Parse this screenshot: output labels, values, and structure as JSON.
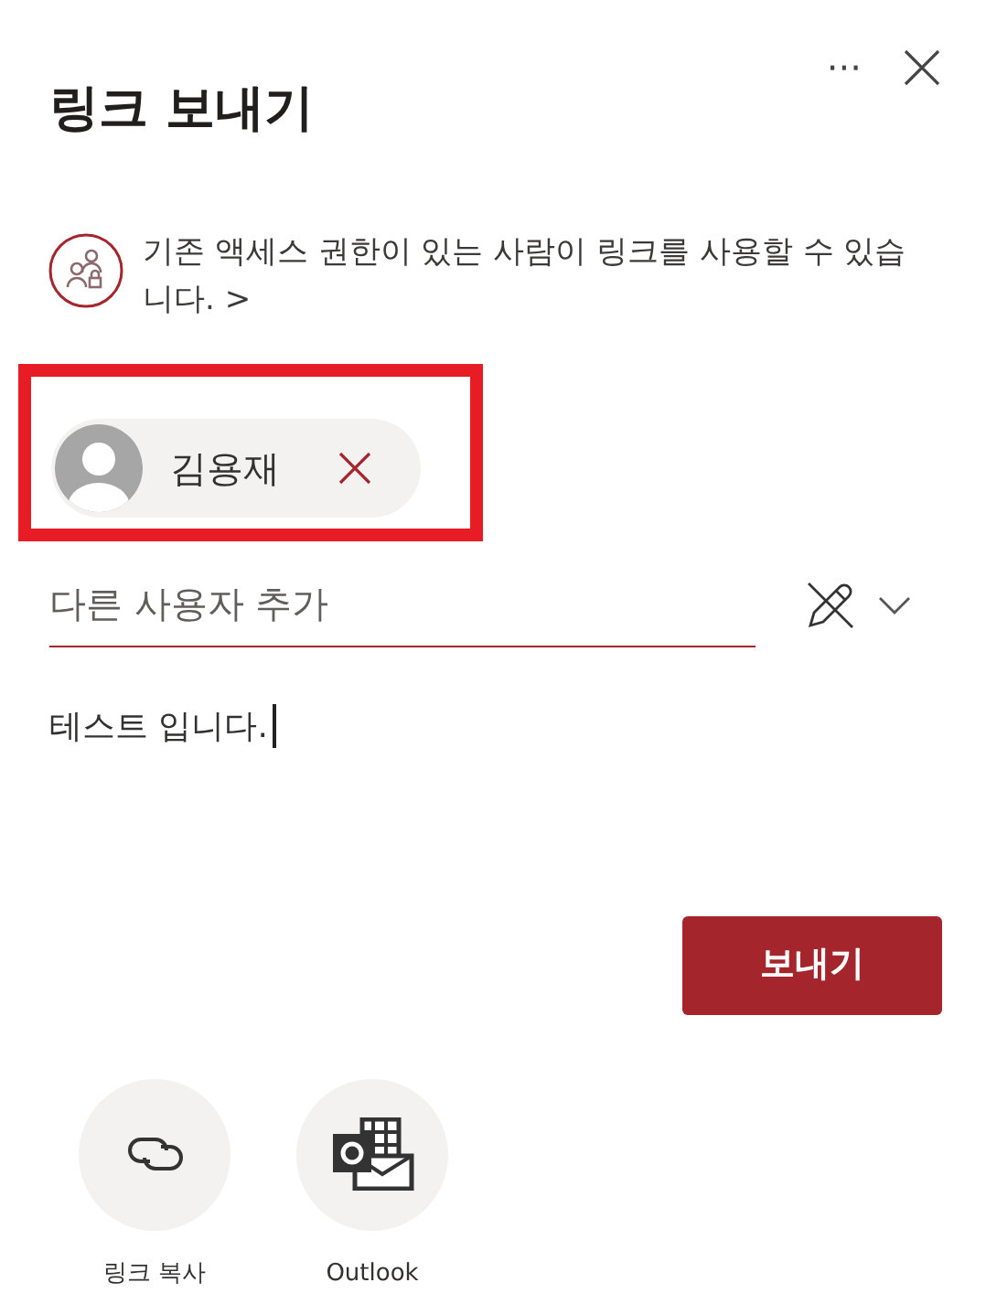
{
  "header": {
    "title": "링크 보내기",
    "more": "···"
  },
  "access_notice": {
    "text": "기존 액세스 권한이 있는 사람이 링크를 사용할 수 있습니다.",
    "chevron": ">"
  },
  "recipients": [
    {
      "name": "김용재",
      "highlighted": true
    }
  ],
  "add_field": {
    "placeholder": "다른 사용자 추가"
  },
  "message": {
    "value": "테스트 입니다."
  },
  "send_button": "보내기",
  "share_options": [
    {
      "kind": "link",
      "label": "링크 복사"
    },
    {
      "kind": "outlook",
      "label": "Outlook"
    }
  ]
}
